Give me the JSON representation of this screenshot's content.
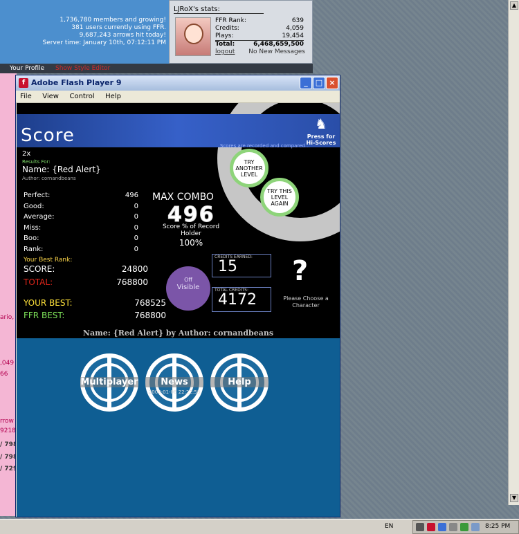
{
  "site": {
    "members": "1,736,780 members and growing!",
    "users_online": "381 users currently using FFR.",
    "arrows_hit": "9,687,243 arrows hit today!",
    "server_time": "Server time: January 10th, 07:12:11 PM",
    "nav": {
      "your_profile": "Your Profile",
      "show_style_editor": "Show Style Editor"
    },
    "left_strip": [
      "ario,",
      ",049",
      "66",
      "rrow",
      "9218",
      "/ 798",
      "/ 798",
      "/ 729"
    ]
  },
  "user_stats": {
    "title": "LJRoX's stats:",
    "rows": [
      {
        "label": "FFR Rank:",
        "value": "639"
      },
      {
        "label": "Credits:",
        "value": "4,059"
      },
      {
        "label": "Plays:",
        "value": "19,454"
      }
    ],
    "total_label": "Total:",
    "total_value": "6,468,659,500",
    "logout": "logout",
    "messages": "No New Messages"
  },
  "flash_window": {
    "title": "Adobe Flash Player 9",
    "menu": [
      "File",
      "View",
      "Control",
      "Help"
    ],
    "controls": {
      "minimize": "_",
      "maximize": "□",
      "close": "×"
    }
  },
  "game": {
    "screen_title": "Score",
    "hiscores_btn": "Press for Hi-Scores",
    "scores_note": "Scores are recorded and compared...",
    "multiplier": "2x",
    "results_for_label": "Results For:",
    "song_name": "Name: {Red Alert}",
    "song_author": "Author: cornandbeans",
    "judgements": [
      {
        "label": "Perfect:",
        "value": "496"
      },
      {
        "label": "Good:",
        "value": "0"
      },
      {
        "label": "Average:",
        "value": "0"
      },
      {
        "label": "Miss:",
        "value": "0"
      },
      {
        "label": "Boo:",
        "value": "0"
      },
      {
        "label": "Rank:",
        "value": "0"
      }
    ],
    "max_combo_label": "MAX COMBO",
    "max_combo_value": "496",
    "record_holder_label": "Score % of Record Holder",
    "record_holder_pct": "100%",
    "best_rank_label": "Your Best Rank:",
    "score_label": "SCORE:",
    "score_value": "24800",
    "total_label": "TOTAL:",
    "total_value": "768800",
    "your_best_label": "YOUR BEST:",
    "your_best_value": "768525",
    "ffr_best_label": "FFR BEST:",
    "ffr_best_value": "768800",
    "visible_toggle_top": "Off",
    "visible_toggle_bottom": "Visible",
    "credits_earned_label": "CREDITS EARNED:",
    "credits_earned_value": "15",
    "total_credits_label": "TOTAL CREDITS:",
    "total_credits_value": "4172",
    "character_placeholder": "?",
    "character_note": "Please Choose a Character",
    "try_another": "TRY ANOTHER LEVEL",
    "try_again": "TRY THIS LEVEL AGAIN",
    "footer_name": "Name: {Red Alert} by Author: cornandbeans",
    "menu": {
      "multiplayer": "Multiplayer",
      "news": "News",
      "news_date": "2008-01-08 22:22:58",
      "help": "Help"
    }
  },
  "taskbar": {
    "language": "EN",
    "time": "8:25 PM"
  },
  "colors": {
    "accent_blue": "#3660c8",
    "panel_blue": "#0f5e93",
    "combo_green": "#8ed47a"
  }
}
